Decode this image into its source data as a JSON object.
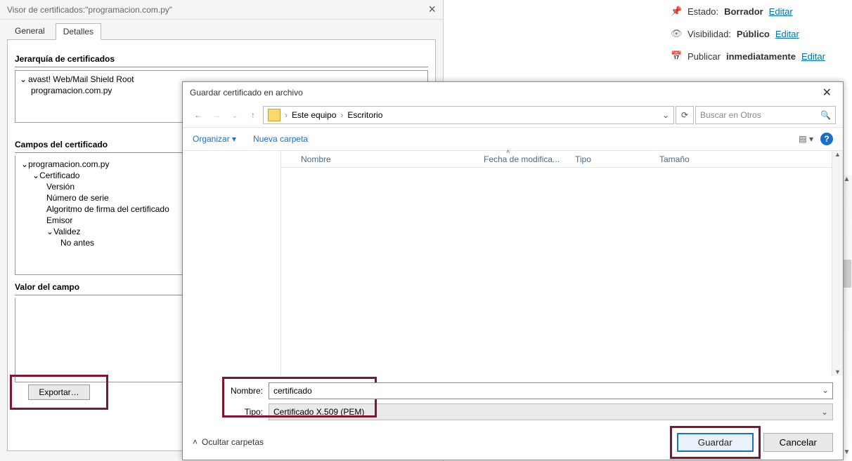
{
  "cert_viewer": {
    "title": "Visor de certificados:\"programacion.com.py\"",
    "tabs": {
      "general": "General",
      "details": "Detalles"
    },
    "hierarchy_label": "Jerarquía de certificados",
    "hierarchy": {
      "root": "avast! Web/Mail Shield Root",
      "leaf": "programacion.com.py"
    },
    "fields_label": "Campos del certificado",
    "fields": {
      "root": "programacion.com.py",
      "cert": "Certificado",
      "version": "Versión",
      "serial": "Número de serie",
      "sigalg": "Algoritmo de firma del certificado",
      "issuer": "Emisor",
      "validity": "Validez",
      "not_before": "No antes"
    },
    "value_label": "Valor del campo",
    "export_btn": "Exportar…"
  },
  "publish": {
    "status_label": "Estado:",
    "status_value": "Borrador",
    "visibility_label": "Visibilidad:",
    "visibility_value": "Público",
    "schedule_label": "Publicar",
    "schedule_value": "inmediatamente",
    "edit": "Editar"
  },
  "save_dialog": {
    "title": "Guardar certificado en archivo",
    "breadcrumb": {
      "root": "Este equipo",
      "leaf": "Escritorio"
    },
    "search_placeholder": "Buscar en Otros",
    "organize": "Organizar",
    "new_folder": "Nueva carpeta",
    "columns": {
      "name": "Nombre",
      "date": "Fecha de modifica...",
      "type": "Tipo",
      "size": "Tamaño"
    },
    "form": {
      "name_label": "Nombre:",
      "name_value": "certificado",
      "type_label": "Tipo:",
      "type_value": "Certificado X.509 (PEM)"
    },
    "hide_folders": "Ocultar carpetas",
    "save_btn": "Guardar",
    "cancel_btn": "Cancelar"
  }
}
